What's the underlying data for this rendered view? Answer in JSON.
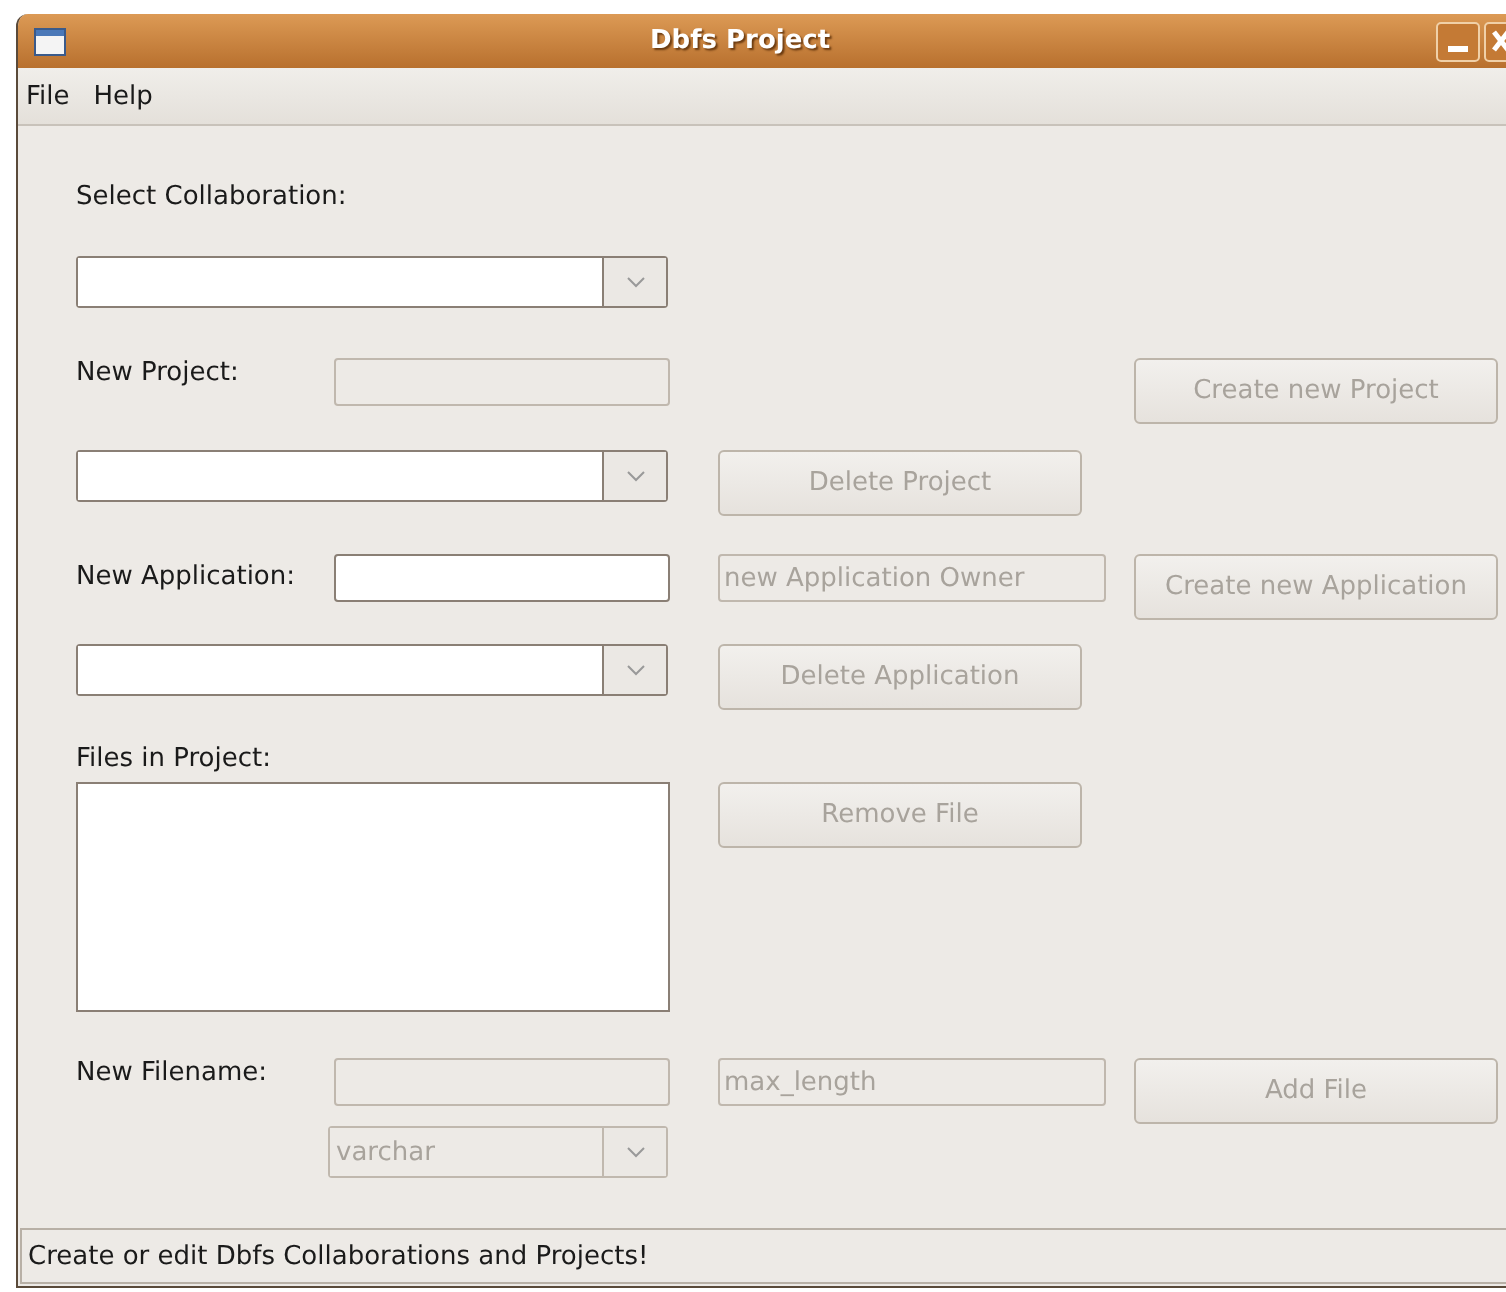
{
  "window": {
    "title": "Dbfs Project"
  },
  "menu": [
    {
      "label": "File"
    },
    {
      "label": "Help"
    }
  ],
  "collaboration": {
    "label": "Select Collaboration:"
  },
  "new_project": {
    "label": "New Project:",
    "field_disabled": true,
    "create_button": {
      "label": "Create new Project",
      "disabled": true
    }
  },
  "project_select": {
    "delete_button": {
      "label": "Delete Project",
      "disabled": true
    }
  },
  "new_application": {
    "label": "New Application:",
    "field_disabled": false,
    "owner_field": {
      "placeholder": "new Application Owner",
      "disabled": true
    },
    "create_button": {
      "label": "Create new Application",
      "disabled": true
    }
  },
  "application_select": {
    "delete_button": {
      "label": "Delete Application",
      "disabled": true
    }
  },
  "files": {
    "label": "Files in Project:",
    "remove_button": {
      "label": "Remove File",
      "disabled": true
    }
  },
  "new_file": {
    "label": "New Filename:",
    "field_disabled": true,
    "length_field": {
      "placeholder": "max_length",
      "disabled": true
    },
    "add_button": {
      "label": "Add File",
      "disabled": true
    },
    "type_combo": {
      "value": "varchar",
      "disabled": true
    }
  },
  "status_bar": "Create or edit Dbfs Collaborations and Projects!"
}
